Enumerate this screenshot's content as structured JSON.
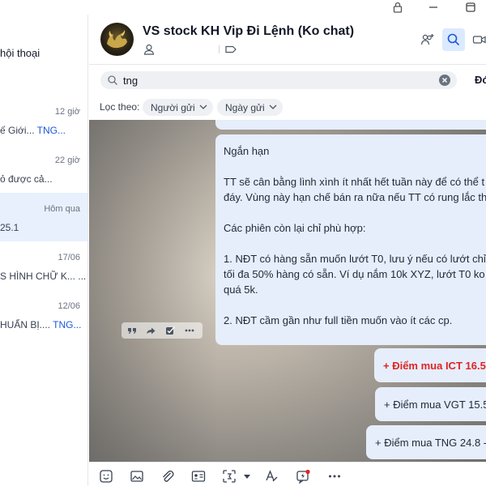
{
  "conversation_list": {
    "header": "hội thoại",
    "items": [
      {
        "time": "12 giờ",
        "preview_text": "ế Giới... ",
        "preview_highlight": "TNG...",
        "active": false
      },
      {
        "time": "22 giờ",
        "preview_text": "ỏ được cả...",
        "preview_highlight": "",
        "active": false
      },
      {
        "time": "Hôm qua",
        "preview_text": "25.1",
        "preview_highlight": "",
        "active": true
      },
      {
        "time": "17/06",
        "preview_text": "S HÌNH CHỮ K... ...",
        "preview_highlight": "",
        "active": false
      },
      {
        "time": "12/06",
        "preview_text": "HUẨN BỊ.... ",
        "preview_highlight": "TNG...",
        "active": false
      }
    ]
  },
  "chat": {
    "title": "VS stock KH Vip Đi Lệnh (Ko chat)"
  },
  "search": {
    "value": "tng",
    "extra_label": "Đó"
  },
  "filters": {
    "label": "Lọc theo:",
    "sender": "Người gửi",
    "date": "Ngày gửi"
  },
  "messages": {
    "main_lines": [
      "Ngắn hạn",
      "",
      "TT sẽ cân bằng lình xình ít nhất hết tuần này để có thể t",
      "đáy. Vùng này hạn chế bán ra nữa nếu TT có rung lắc th",
      "",
      "Các phiên còn lại chỉ phù hợp:",
      "",
      "1. NĐT có hàng sẵn muốn lướt T0, lưu ý nếu có lướt chỉ l",
      "tối đa 50% hàng có sẵn. Ví dụ nắm 10k XYZ, lướt T0 ko n",
      "quá 5k.",
      "",
      "2. NĐT cầm gần như full tiền muốn vào ít các cp."
    ],
    "buy_ict": "+ Điểm mua ICT 16.5-",
    "buy_vgt": "+ Điểm mua VGT 15.5-",
    "buy_tng": "+ Điểm mua TNG 24.8 -"
  },
  "colors": {
    "accent": "#1a56db",
    "highlight_red": "#e02424",
    "bubble": "#e6eefb",
    "active_row": "#e8f0fe"
  }
}
